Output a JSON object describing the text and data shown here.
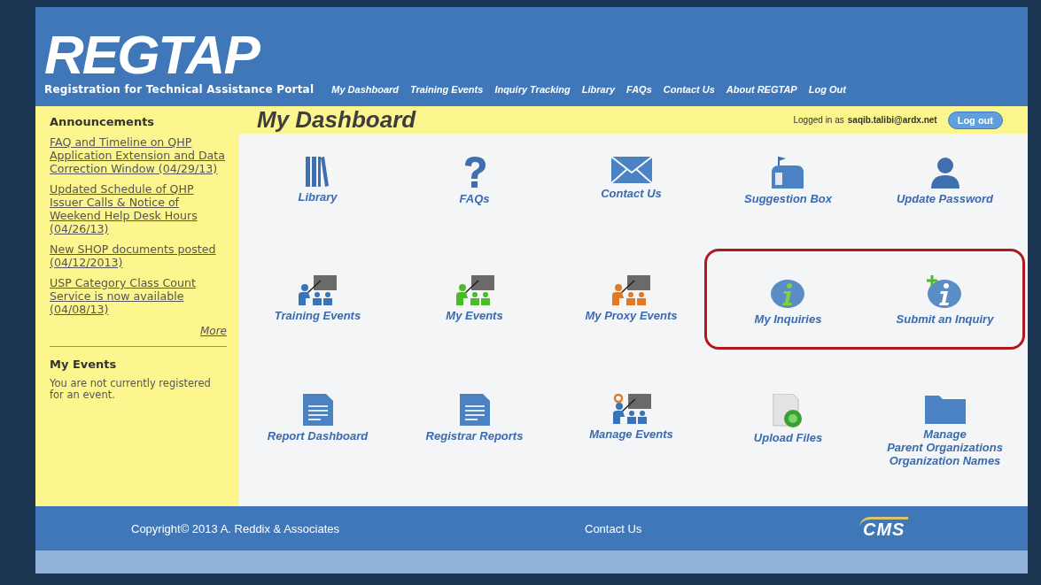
{
  "header": {
    "logo": "REGTAP",
    "tagline": "Registration for Technical Assistance Portal",
    "nav": [
      {
        "label": "My Dashboard"
      },
      {
        "label": "Training Events"
      },
      {
        "label": "Inquiry Tracking"
      },
      {
        "label": "Library"
      },
      {
        "label": "FAQs"
      },
      {
        "label": "Contact Us"
      },
      {
        "label": "About REGTAP"
      },
      {
        "label": "Log Out"
      }
    ]
  },
  "sidebar": {
    "announcements_title": "Announcements",
    "announcements": [
      "FAQ and Timeline on QHP Application Extension and Data Correction Window (04/29/13)",
      "Updated Schedule of QHP Issuer Calls & Notice of Weekend Help Desk Hours (04/26/13)",
      "New SHOP documents posted (04/12/2013)",
      "USP Category Class Count Service is now available (04/08/13)"
    ],
    "more": "More",
    "events_title": "My Events",
    "events_text": "You are not currently registered for an event."
  },
  "page": {
    "title": "My Dashboard",
    "logged_in_label": "Logged in as",
    "user": "saqib.talibi@ardx.net",
    "logout_button": "Log out"
  },
  "tile_rows": [
    {
      "tiles": [
        {
          "kind": "library",
          "label": "Library"
        },
        {
          "kind": "question",
          "label": "FAQs"
        },
        {
          "kind": "envelope",
          "label": "Contact Us"
        },
        {
          "kind": "mailbox",
          "label": "Suggestion Box"
        },
        {
          "kind": "person",
          "label": "Update Password"
        }
      ]
    },
    {
      "tiles": [
        {
          "kind": "teacher",
          "color": "#3a74b8",
          "label": "Training Events"
        },
        {
          "kind": "teacher",
          "color": "#4cbb2a",
          "label": "My Events"
        },
        {
          "kind": "teacher",
          "color": "#e07a26",
          "label": "My Proxy Events"
        }
      ],
      "highlighted_tiles": [
        {
          "kind": "info",
          "label": "My Inquiries"
        },
        {
          "kind": "info-plus",
          "label": "Submit an Inquiry"
        }
      ]
    },
    {
      "tiles": [
        {
          "kind": "document",
          "label": "Report Dashboard"
        },
        {
          "kind": "document",
          "label": "Registrar Reports"
        },
        {
          "kind": "teacher-gear",
          "color": "#3a74b8",
          "label": "Manage Events"
        },
        {
          "kind": "upload",
          "label": "Upload Files"
        },
        {
          "kind": "folder",
          "label": "Manage\nParent Organizations\nOrganization Names"
        }
      ]
    }
  ],
  "footer": {
    "copyright": "Copyright© 2013 A. Reddix & Associates",
    "contact": "Contact Us",
    "logo": "CMS"
  }
}
